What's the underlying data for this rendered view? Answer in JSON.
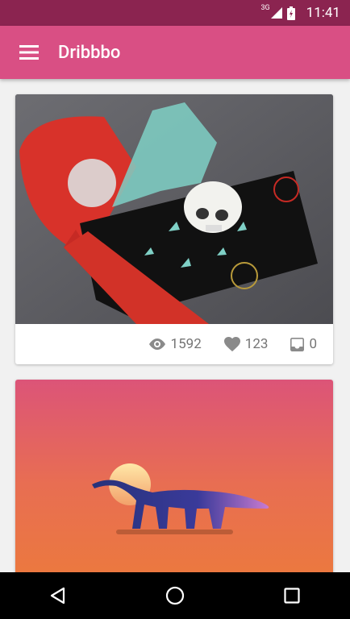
{
  "status_bar": {
    "network": "3G",
    "time": "11:41"
  },
  "app_bar": {
    "title": "Dribbbo"
  },
  "shots": [
    {
      "views": "1592",
      "likes": "123",
      "comments": "0"
    },
    {}
  ],
  "colors": {
    "status_bar": "#8b2450",
    "app_bar": "#d94f84",
    "background": "#f1f1f1"
  }
}
